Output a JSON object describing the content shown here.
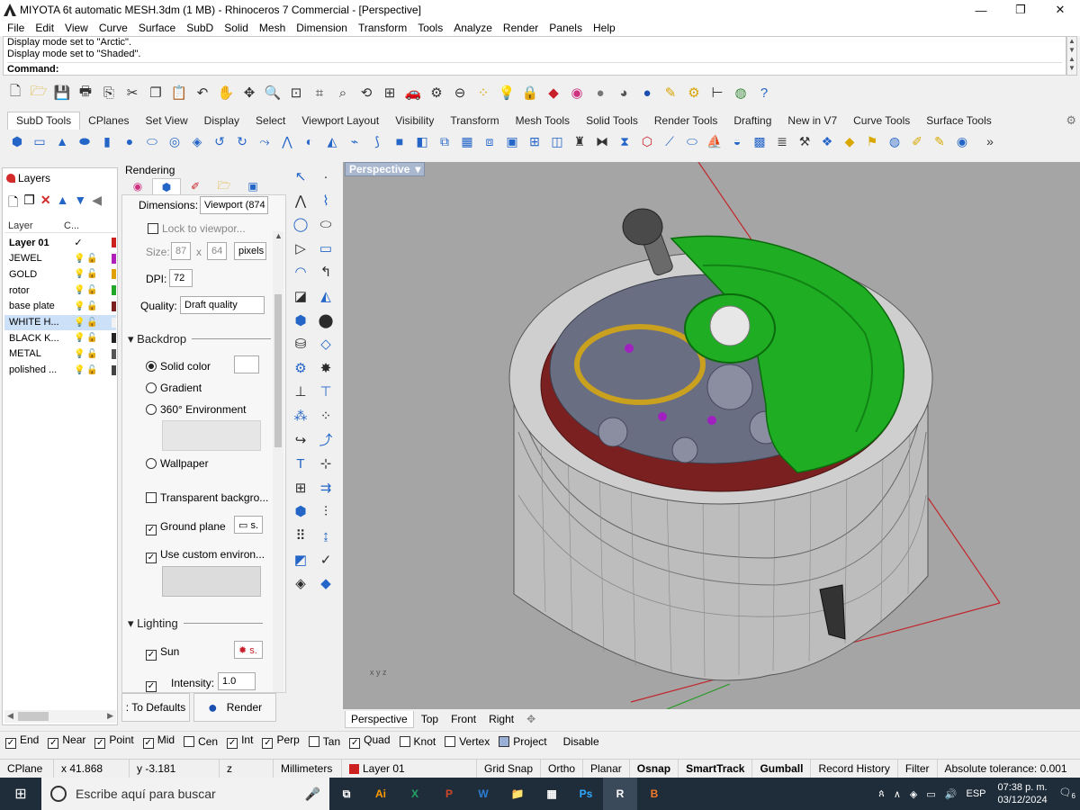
{
  "window": {
    "title": "MIYOTA 6t automatic MESH.3dm (1 MB) - Rhinoceros 7 Commercial - [Perspective]",
    "minimize": "—",
    "restore": "❐",
    "close": "✕"
  },
  "menu": [
    "File",
    "Edit",
    "View",
    "Curve",
    "Surface",
    "SubD",
    "Solid",
    "Mesh",
    "Dimension",
    "Transform",
    "Tools",
    "Analyze",
    "Render",
    "Panels",
    "Help"
  ],
  "command": {
    "history": [
      "Display mode set to \"Arctic\".",
      "Display mode set to \"Shaded\"."
    ],
    "label": "Command:"
  },
  "toolbar_tabs": [
    "SubD Tools",
    "CPlanes",
    "Set View",
    "Display",
    "Select",
    "Viewport Layout",
    "Visibility",
    "Transform",
    "Mesh Tools",
    "Solid Tools",
    "Render Tools",
    "Drafting",
    "New in V7",
    "Curve Tools",
    "Surface Tools"
  ],
  "layers": {
    "tab_label": "Layers",
    "col_layer": "Layer",
    "col_current": "C...",
    "rows": [
      {
        "name": "Layer 01",
        "current": "✓",
        "color": "#cc1f1f"
      },
      {
        "name": "JEWEL",
        "color": "#b01fb8"
      },
      {
        "name": "GOLD",
        "color": "#e0a000"
      },
      {
        "name": "rotor",
        "color": "#1fa82a"
      },
      {
        "name": "base plate",
        "color": "#7a1e1e"
      },
      {
        "name": "WHITE H...",
        "color": "#f2f2f2"
      },
      {
        "name": "BLACK K...",
        "color": "#222222"
      },
      {
        "name": "METAL",
        "color": "#555555"
      },
      {
        "name": "polished ...",
        "color": "#444444"
      }
    ]
  },
  "rendering": {
    "title": "Rendering",
    "dimensions_label": "Dimensions:",
    "dimensions_value": "Viewport (874",
    "lock_label": "Lock to viewpor...",
    "size_label": "Size:",
    "size_w": "87",
    "size_x": "x",
    "size_h": "64",
    "size_unit": "pixels",
    "dpi_label": "DPI:",
    "dpi_value": "72",
    "quality_label": "Quality:",
    "quality_value": "Draft quality",
    "backdrop_label": "Backdrop",
    "solid_color": "Solid color",
    "gradient": "Gradient",
    "environment": "360° Environment",
    "wallpaper": "Wallpaper",
    "transparent": "Transparent backgro...",
    "ground_plane": "Ground plane",
    "custom_env": "Use custom environ...",
    "lighting_label": "Lighting",
    "sun": "Sun",
    "intensity_label": "Intensity:",
    "intensity_value": "1.0",
    "defaults_button": ": To Defaults",
    "render_button": "Render"
  },
  "viewport": {
    "name": "Perspective",
    "tabs": [
      "Perspective",
      "Top",
      "Front",
      "Right"
    ],
    "add_tab": "✥"
  },
  "osnaps": [
    {
      "label": "End",
      "checked": true
    },
    {
      "label": "Near",
      "checked": true
    },
    {
      "label": "Point",
      "checked": true
    },
    {
      "label": "Mid",
      "checked": true
    },
    {
      "label": "Cen",
      "checked": false
    },
    {
      "label": "Int",
      "checked": true
    },
    {
      "label": "Perp",
      "checked": true
    },
    {
      "label": "Tan",
      "checked": false
    },
    {
      "label": "Quad",
      "checked": true
    },
    {
      "label": "Knot",
      "checked": false
    },
    {
      "label": "Vertex",
      "checked": false
    },
    {
      "label": "Project",
      "checked": false
    },
    {
      "label": "Disable",
      "checked": false
    }
  ],
  "status": {
    "cplane": "CPlane",
    "x": "x 41.868",
    "y": "y -3.181",
    "z": "z",
    "units": "Millimeters",
    "layer": "Layer 01",
    "layer_color": "#cc1f1f",
    "grid_snap": "Grid Snap",
    "ortho": "Ortho",
    "planar": "Planar",
    "osnap": "Osnap",
    "smarttrack": "SmartTrack",
    "gumball": "Gumball",
    "record_history": "Record History",
    "filter": "Filter",
    "tolerance": "Absolute tolerance: 0.001"
  },
  "taskbar": {
    "search_placeholder": "Escribe aquí para buscar",
    "apps": [
      "Ai",
      "X",
      "P",
      "W",
      "📁",
      "▦",
      "Ps",
      "R",
      "B"
    ],
    "language": "ESP",
    "time": "07:38 p. m.",
    "date": "03/12/2024",
    "notifications": "6"
  }
}
